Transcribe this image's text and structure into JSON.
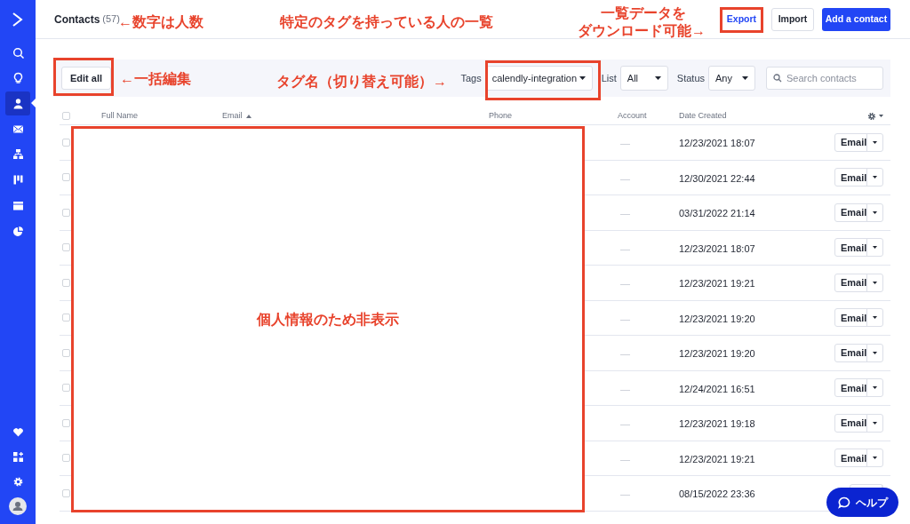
{
  "sidebar": {
    "items": [
      {
        "selected": false
      },
      {
        "selected": false
      },
      {
        "selected": true
      },
      {
        "selected": false
      },
      {
        "selected": false
      },
      {
        "selected": false
      },
      {
        "selected": false
      },
      {
        "selected": false
      }
    ],
    "bottom_items": [
      {
        "selected": false
      },
      {
        "selected": false
      },
      {
        "selected": false
      },
      {
        "selected": false
      }
    ]
  },
  "header": {
    "title": "Contacts",
    "count": "(57)",
    "buttons": [
      {
        "label": "Export",
        "kind": "link"
      },
      {
        "label": "Import",
        "kind": "outline"
      },
      {
        "label": "Add a contact",
        "kind": "primary"
      }
    ]
  },
  "filters": {
    "edit_all": "Edit all",
    "selects": [
      {
        "label": "Tags",
        "value": "calendly-integration"
      },
      {
        "label": "List",
        "value": "All"
      },
      {
        "label": "Status",
        "value": "Any"
      }
    ],
    "search": {
      "placeholder": "Search contacts"
    }
  },
  "table": {
    "columns": [
      {
        "label": "Full Name",
        "sorted": false
      },
      {
        "label": "Email",
        "sorted": true
      },
      {
        "label": "Phone",
        "sorted": false
      },
      {
        "label": "Account",
        "sorted": false
      },
      {
        "label": "Date Created",
        "sorted": false
      }
    ],
    "rows": [
      {
        "checked": false,
        "account": "—",
        "date": "12/23/2021 18:07",
        "action": "Email"
      },
      {
        "checked": false,
        "account": "—",
        "date": "12/30/2021 22:44",
        "action": "Email"
      },
      {
        "checked": false,
        "account": "—",
        "date": "03/31/2022 21:14",
        "action": "Email"
      },
      {
        "checked": false,
        "account": "—",
        "date": "12/23/2021 18:07",
        "action": "Email"
      },
      {
        "checked": false,
        "account": "—",
        "date": "12/23/2021 19:21",
        "action": "Email"
      },
      {
        "checked": false,
        "account": "—",
        "date": "12/23/2021 19:20",
        "action": "Email"
      },
      {
        "checked": false,
        "account": "—",
        "date": "12/23/2021 19:20",
        "action": "Email"
      },
      {
        "checked": false,
        "account": "—",
        "date": "12/24/2021 16:51",
        "action": "Email"
      },
      {
        "checked": false,
        "account": "—",
        "date": "12/23/2021 19:18",
        "action": "Email"
      },
      {
        "checked": false,
        "account": "—",
        "date": "12/23/2021 19:21",
        "action": "Email"
      },
      {
        "checked": false,
        "account": "—",
        "date": "08/15/2022 23:36"
      }
    ],
    "select_all": {
      "checked": false
    }
  },
  "redaction": {
    "label": "個人情報のため非表示"
  },
  "annotations": [
    "←数字は人数",
    "特定のタグを持っている人の一覧",
    "一覧データを",
    "ダウンロード可能→",
    "←一括編集",
    "タグ名（切り替え可能）→"
  ],
  "help": {
    "label": "ヘルプ"
  }
}
